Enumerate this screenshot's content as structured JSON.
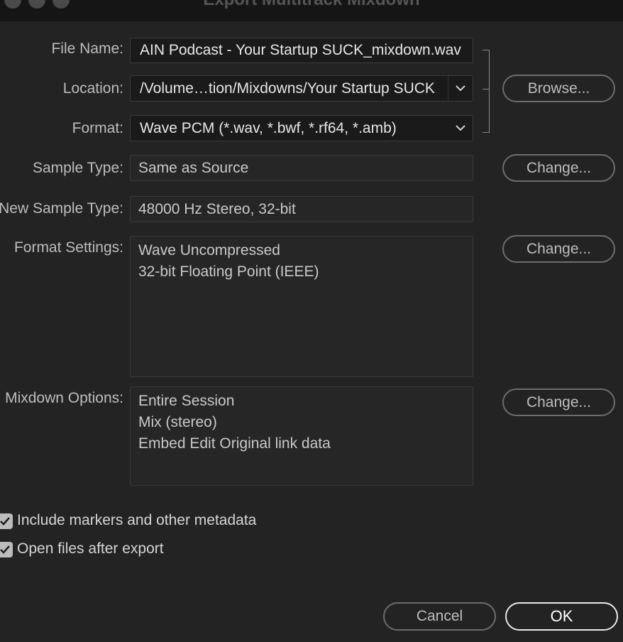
{
  "window": {
    "title": "Export Multitrack Mixdown"
  },
  "labels": {
    "file_name": "File Name:",
    "location": "Location:",
    "format": "Format:",
    "sample_type": "Sample Type:",
    "new_sample_type": "New Sample Type:",
    "format_settings": "Format Settings:",
    "mixdown_options": "Mixdown Options:"
  },
  "fields": {
    "file_name": "AIN Podcast - Your Startup SUCK_mixdown.wav",
    "location": "/Volume…tion/Mixdowns/Your Startup SUCK",
    "format": "Wave PCM (*.wav, *.bwf, *.rf64, *.amb)",
    "sample_type": "Same as Source",
    "new_sample_type": "48000 Hz Stereo, 32-bit",
    "format_settings": [
      "Wave Uncompressed",
      "32-bit Floating Point (IEEE)"
    ],
    "mixdown_options": [
      "Entire Session",
      "Mix (stereo)",
      "Embed Edit Original link data"
    ]
  },
  "buttons": {
    "browse": "Browse...",
    "change_sample_type": "Change...",
    "change_format_settings": "Change...",
    "change_mixdown": "Change...",
    "cancel": "Cancel",
    "ok": "OK"
  },
  "checkboxes": {
    "include_markers": {
      "label": "Include markers and other metadata",
      "checked": true
    },
    "open_files": {
      "label": "Open files after export",
      "checked": true
    }
  },
  "icons": {
    "dropdown": "chevron-down-icon",
    "check": "checkmark-icon"
  }
}
